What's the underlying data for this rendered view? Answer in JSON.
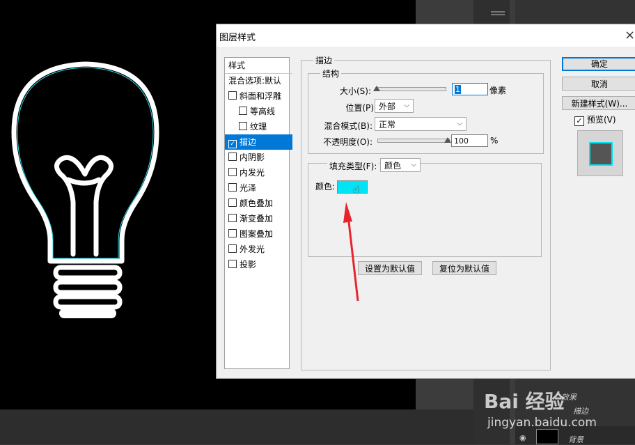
{
  "dialog": {
    "title": "图层样式",
    "close_label": "×"
  },
  "styles": {
    "header": "样式",
    "items": [
      {
        "label": "混合选项:默认",
        "checkbox": false,
        "checked": false,
        "indent": false,
        "selected": false
      },
      {
        "label": "斜面和浮雕",
        "checkbox": true,
        "checked": false,
        "indent": false,
        "selected": false
      },
      {
        "label": "等高线",
        "checkbox": true,
        "checked": false,
        "indent": true,
        "selected": false
      },
      {
        "label": "纹理",
        "checkbox": true,
        "checked": false,
        "indent": true,
        "selected": false
      },
      {
        "label": "描边",
        "checkbox": true,
        "checked": true,
        "indent": false,
        "selected": true
      },
      {
        "label": "内阴影",
        "checkbox": true,
        "checked": false,
        "indent": false,
        "selected": false
      },
      {
        "label": "内发光",
        "checkbox": true,
        "checked": false,
        "indent": false,
        "selected": false
      },
      {
        "label": "光泽",
        "checkbox": true,
        "checked": false,
        "indent": false,
        "selected": false
      },
      {
        "label": "颜色叠加",
        "checkbox": true,
        "checked": false,
        "indent": false,
        "selected": false
      },
      {
        "label": "渐变叠加",
        "checkbox": true,
        "checked": false,
        "indent": false,
        "selected": false
      },
      {
        "label": "图案叠加",
        "checkbox": true,
        "checked": false,
        "indent": false,
        "selected": false
      },
      {
        "label": "外发光",
        "checkbox": true,
        "checked": false,
        "indent": false,
        "selected": false
      },
      {
        "label": "投影",
        "checkbox": true,
        "checked": false,
        "indent": false,
        "selected": false
      }
    ]
  },
  "stroke": {
    "section_title": "描边",
    "structure_title": "结构",
    "size_label": "大小(S):",
    "size_value": "1",
    "size_unit": "像素",
    "position_label": "位置(P):",
    "position_value": "外部",
    "blend_label": "混合模式(B):",
    "blend_value": "正常",
    "opacity_label": "不透明度(O):",
    "opacity_value": "100",
    "opacity_unit": "%",
    "fill_type_label": "填充类型(F):",
    "fill_type_value": "颜色",
    "color_label": "颜色:",
    "color_value": "#00e4f6",
    "size_slider_fraction": 0.0,
    "opacity_slider_fraction": 1.0
  },
  "buttons": {
    "ok": "确定",
    "cancel": "取消",
    "new_style": "新建样式(W)...",
    "preview_label": "预览(V)",
    "preview_checked": true,
    "set_default": "设置为默认值",
    "reset_default": "复位为默认值"
  },
  "background": {
    "layer_name": "背景",
    "effects_label": "效果",
    "stroke_label": "描边",
    "watermark": "Bai 经验",
    "watermark_url": "jingyan.baidu.com"
  },
  "colors": {
    "accent": "#0078d7",
    "stroke_color": "#00e4f6"
  },
  "icons": {
    "bulb": "light-bulb-drawing",
    "arrow": "red-arrow",
    "cursor": "hand-cursor-icon"
  }
}
